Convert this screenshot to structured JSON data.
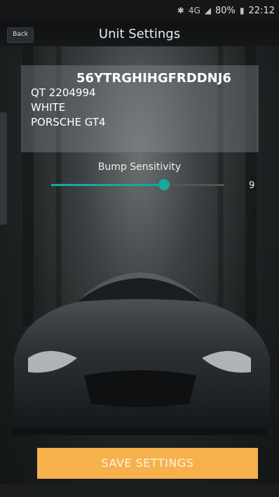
{
  "status": {
    "bluetooth_icon": "bluetooth-icon",
    "network": "4G",
    "battery": "80%",
    "time": "22:12"
  },
  "header": {
    "back_label": "Back",
    "title": "Unit Settings"
  },
  "vehicle": {
    "vin": "56YTRGHIHGFRDDNJ6",
    "unit_id": "QT 2204994",
    "color": "WHITE",
    "model": "PORSCHE  GT4"
  },
  "sensitivity": {
    "label": "Bump Sensitivity",
    "value": "9",
    "level": 0.65,
    "accent": "#18a999"
  },
  "actions": {
    "save_label": "SAVE SETTINGS",
    "save_color": "#f6b14d"
  }
}
